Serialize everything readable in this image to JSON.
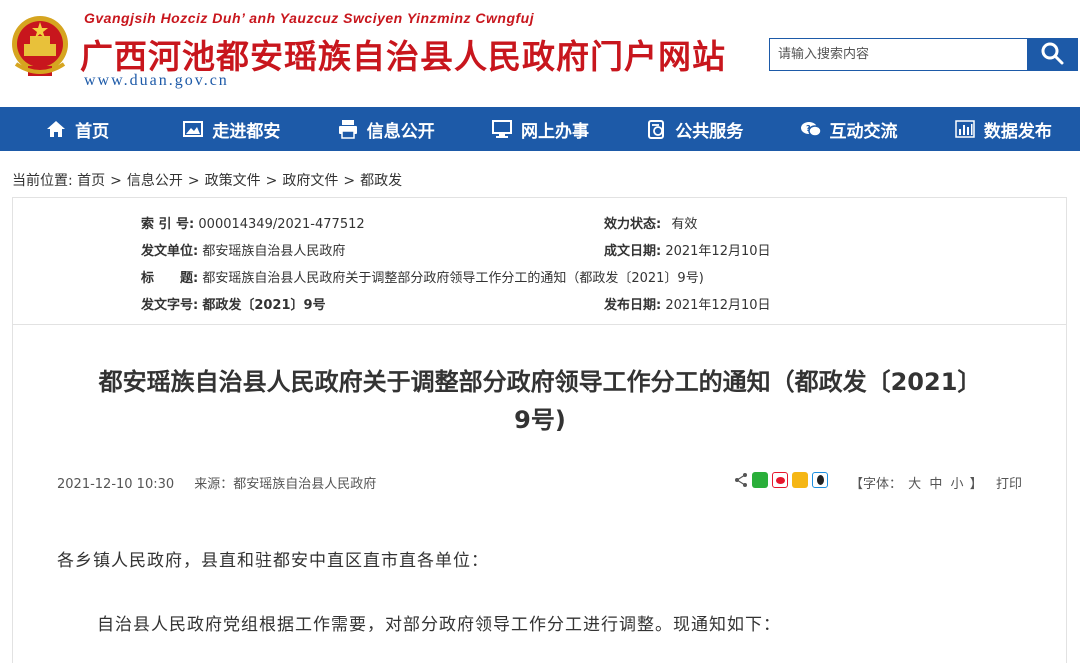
{
  "header": {
    "pinyin": "Gvangjsih Hozciz Duh’ anh Yauzcuz Swciyen Yinzminz Cwngfuj",
    "title": "广西河池都安瑶族自治县人民政府门户网站",
    "url": "www.duan.gov.cn",
    "search_placeholder": "请输入搜索内容",
    "emblem_icon": "national-emblem-icon",
    "search_icon": "search-icon"
  },
  "nav": [
    {
      "label": "首页",
      "icon": "home-icon"
    },
    {
      "label": "走进都安",
      "icon": "image-icon"
    },
    {
      "label": "信息公开",
      "icon": "printer-icon"
    },
    {
      "label": "网上办事",
      "icon": "monitor-icon"
    },
    {
      "label": "公共服务",
      "icon": "clipboard-icon"
    },
    {
      "label": "互动交流",
      "icon": "chat-icon"
    },
    {
      "label": "数据发布",
      "icon": "bar-chart-icon"
    }
  ],
  "breadcrumb": {
    "prefix": "当前位置:",
    "items": [
      "首页",
      "信息公开",
      "政策文件",
      "政府文件",
      "都政发"
    ]
  },
  "info": {
    "index_label": "索 引 号:",
    "index_value": "000014349/2021-477512",
    "status_label": "效力状态:",
    "status_value": "有效",
    "issuer_label": "发文单位:",
    "issuer_value": "都安瑶族自治县人民政府",
    "date_label": "成文日期:",
    "date_value": "2021年12月10日",
    "title_label": "标　　题:",
    "title_value": "都安瑶族自治县人民政府关于调整部分政府领导工作分工的通知（都政发〔2021〕9号)",
    "doc_no_label": "发文字号:",
    "doc_no_value": "都政发〔2021〕9号",
    "publish_label": "发布日期:",
    "publish_value": "2021年12月10日"
  },
  "article": {
    "title_line1": "都安瑶族自治县人民政府关于调整部分政府领导工作分工的通知（都政发〔2021〕",
    "title_line2": "9号)",
    "datetime": "2021-12-10 10:30",
    "source": "来源：都安瑶族自治县人民政府",
    "font_label_open": "【字体：",
    "font_large": "大",
    "font_medium": "中",
    "font_small": "小",
    "font_label_close": "】",
    "print": "打印",
    "para1": "各乡镇人民政府，县直和驻都安中直区直市直各单位：",
    "para2": "自治县人民政府党组根据工作需要，对部分政府领导工作分工进行调整。现通知如下："
  },
  "colors": {
    "brand_red": "#c8161d",
    "brand_blue": "#1d5aa8"
  }
}
